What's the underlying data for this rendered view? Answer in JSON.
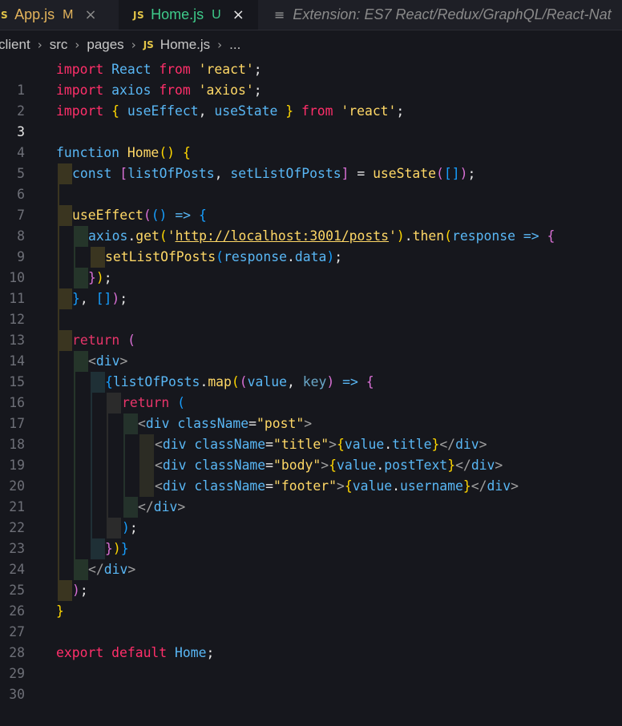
{
  "tabs": [
    {
      "icon": "JS",
      "label": "App.js",
      "status": "M",
      "close": "×"
    },
    {
      "icon": "JS",
      "label": "Home.js",
      "status": "U",
      "close": "×"
    },
    {
      "icon": "≡",
      "label": "Extension: ES7 React/Redux/GraphQL/React-Nat"
    }
  ],
  "breadcrumb": {
    "items": [
      "client",
      "src",
      "pages"
    ],
    "file_icon": "JS",
    "file": "Home.js",
    "more": "..."
  },
  "editor": {
    "active_line": 3,
    "lines": [
      {
        "n": "1"
      },
      {
        "n": "2"
      },
      {
        "n": "3"
      },
      {
        "n": "4"
      },
      {
        "n": "5"
      },
      {
        "n": "6"
      },
      {
        "n": "7"
      },
      {
        "n": "8"
      },
      {
        "n": "9"
      },
      {
        "n": "10"
      },
      {
        "n": "11"
      },
      {
        "n": "12"
      },
      {
        "n": "13"
      },
      {
        "n": "14"
      },
      {
        "n": "15"
      },
      {
        "n": "16"
      },
      {
        "n": "17"
      },
      {
        "n": "18"
      },
      {
        "n": "19"
      },
      {
        "n": "20"
      },
      {
        "n": "21"
      },
      {
        "n": "22"
      },
      {
        "n": "23"
      },
      {
        "n": "24"
      },
      {
        "n": "25"
      },
      {
        "n": "26"
      },
      {
        "n": "27"
      },
      {
        "n": "28"
      },
      {
        "n": "29"
      },
      {
        "n": "30"
      }
    ],
    "tokens": {
      "l1": [
        "import",
        "React",
        "from",
        "'react'",
        ";"
      ],
      "l2": [
        "import",
        "axios",
        "from",
        "'axios'",
        ";"
      ],
      "l3": [
        "import",
        "{",
        "useEffect",
        ",",
        "useState",
        "}",
        "from",
        "'react'",
        ";"
      ],
      "l5": [
        "function",
        "Home",
        "()",
        "{"
      ],
      "l6": [
        "const",
        "[",
        "listOfPosts",
        ",",
        "setListOfPosts",
        "]",
        "=",
        "useState",
        "(",
        "[]",
        ")",
        ";"
      ],
      "l8": [
        "useEffect",
        "(",
        "()",
        "=>",
        "{"
      ],
      "l9": [
        "axios",
        ".",
        "get",
        "(",
        "'",
        "http://localhost:3001/posts",
        "'",
        ")",
        ".",
        "then",
        "(",
        "response",
        "=>",
        "{"
      ],
      "l10": [
        "setListOfPosts",
        "(",
        "response",
        ".",
        "data",
        ")",
        ";"
      ],
      "l11": [
        "}",
        ")",
        ";"
      ],
      "l12": [
        "}",
        ",",
        "[]",
        ")",
        ";"
      ],
      "l14": [
        "return",
        "("
      ],
      "l15": [
        "<",
        "div",
        ">"
      ],
      "l16": [
        "{",
        "listOfPosts",
        ".",
        "map",
        "(",
        "(",
        "value",
        ",",
        "key",
        ")",
        "=>",
        "{"
      ],
      "l17": [
        "return",
        "("
      ],
      "l18": [
        "<",
        "div",
        "className",
        "=",
        "\"post\"",
        ">"
      ],
      "l19": [
        "<",
        "div",
        "className",
        "=",
        "\"title\"",
        ">",
        "{",
        "value",
        ".",
        "title",
        "}",
        "</",
        "div",
        ">"
      ],
      "l20": [
        "<",
        "div",
        "className",
        "=",
        "\"body\"",
        ">",
        "{",
        "value",
        ".",
        "postText",
        "}",
        "</",
        "div",
        ">"
      ],
      "l21": [
        "<",
        "div",
        "className",
        "=",
        "\"footer\"",
        ">",
        "{",
        "value",
        ".",
        "username",
        "}",
        "</",
        "div",
        ">"
      ],
      "l22": [
        "</",
        "div",
        ">"
      ],
      "l23": [
        ")",
        ";"
      ],
      "l24": [
        "}",
        ")",
        "}"
      ],
      "l25": [
        "</",
        "div",
        ">"
      ],
      "l26": [
        ")",
        ";"
      ],
      "l27": [
        "}"
      ],
      "l29": [
        "export",
        "default",
        "Home",
        ";"
      ]
    }
  },
  "colors": {
    "background": "#16171d",
    "keyword": "#ff2f6a",
    "function": "#ffd866",
    "variable": "#59b7f5",
    "bracket_yellow": "#ffd700",
    "bracket_purple": "#da70d6",
    "bracket_blue": "#179fff",
    "tab_modified": "#e4b45c",
    "tab_untracked": "#3ecb8a"
  }
}
